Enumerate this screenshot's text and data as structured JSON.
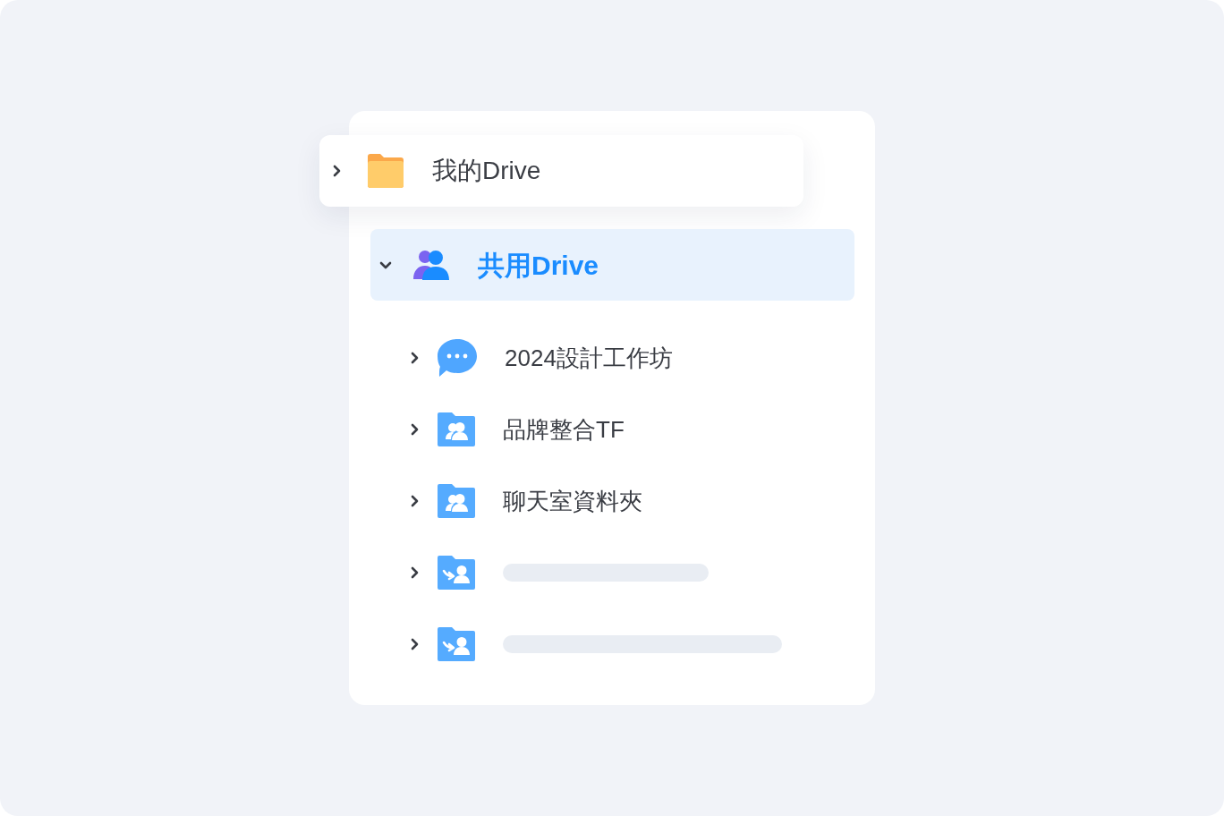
{
  "tree": [
    {
      "label": "我的Drive",
      "kind": "my-drive",
      "expanded": false,
      "selected": false,
      "floating": true
    },
    {
      "label": "共用Drive",
      "kind": "shared-drive",
      "expanded": true,
      "selected": true,
      "floating": false,
      "children": [
        {
          "label": "2024設計工作坊",
          "kind": "chat",
          "expanded": false
        },
        {
          "label": "品牌整合TF",
          "kind": "team-folder",
          "expanded": false
        },
        {
          "label": "聊天室資料夾",
          "kind": "team-folder",
          "expanded": false
        },
        {
          "kind": "incoming-folder",
          "expanded": false,
          "loading": true
        },
        {
          "kind": "incoming-folder",
          "expanded": false,
          "loading": true
        }
      ]
    }
  ]
}
